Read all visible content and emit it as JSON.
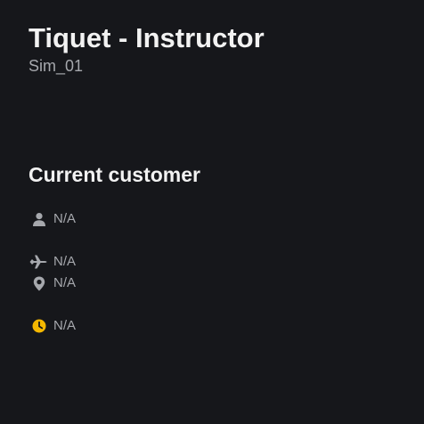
{
  "header": {
    "title": "Tiquet - Instructor",
    "subtitle": "Sim_01"
  },
  "current_customer": {
    "heading": "Current customer",
    "name": {
      "icon": "person-icon",
      "value": "N/A"
    },
    "flight": {
      "icon": "airplane-icon",
      "value": "N/A"
    },
    "location": {
      "icon": "location-pin-icon",
      "value": "N/A"
    },
    "time": {
      "icon": "clock-icon",
      "value": "N/A"
    }
  },
  "colors": {
    "background": "#16171b",
    "title": "#f2f2f2",
    "muted": "#a6a8ad",
    "icon": "#a6a8ad",
    "clock_accent": "#f5b800"
  }
}
